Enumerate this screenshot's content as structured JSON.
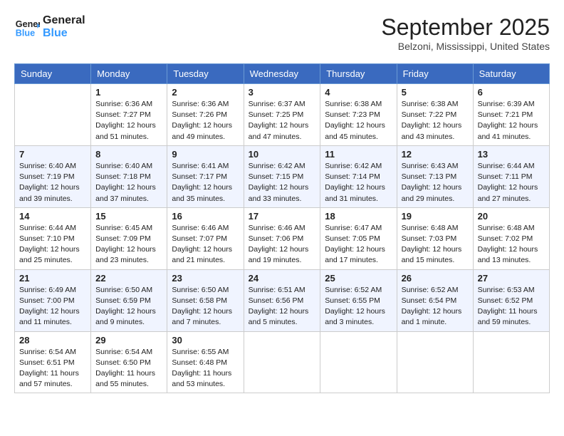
{
  "logo": {
    "line1": "General",
    "line2": "Blue"
  },
  "title": "September 2025",
  "location": "Belzoni, Mississippi, United States",
  "weekdays": [
    "Sunday",
    "Monday",
    "Tuesday",
    "Wednesday",
    "Thursday",
    "Friday",
    "Saturday"
  ],
  "weeks": [
    [
      {
        "day": "",
        "info": ""
      },
      {
        "day": "1",
        "info": "Sunrise: 6:36 AM\nSunset: 7:27 PM\nDaylight: 12 hours\nand 51 minutes."
      },
      {
        "day": "2",
        "info": "Sunrise: 6:36 AM\nSunset: 7:26 PM\nDaylight: 12 hours\nand 49 minutes."
      },
      {
        "day": "3",
        "info": "Sunrise: 6:37 AM\nSunset: 7:25 PM\nDaylight: 12 hours\nand 47 minutes."
      },
      {
        "day": "4",
        "info": "Sunrise: 6:38 AM\nSunset: 7:23 PM\nDaylight: 12 hours\nand 45 minutes."
      },
      {
        "day": "5",
        "info": "Sunrise: 6:38 AM\nSunset: 7:22 PM\nDaylight: 12 hours\nand 43 minutes."
      },
      {
        "day": "6",
        "info": "Sunrise: 6:39 AM\nSunset: 7:21 PM\nDaylight: 12 hours\nand 41 minutes."
      }
    ],
    [
      {
        "day": "7",
        "info": "Sunrise: 6:40 AM\nSunset: 7:19 PM\nDaylight: 12 hours\nand 39 minutes."
      },
      {
        "day": "8",
        "info": "Sunrise: 6:40 AM\nSunset: 7:18 PM\nDaylight: 12 hours\nand 37 minutes."
      },
      {
        "day": "9",
        "info": "Sunrise: 6:41 AM\nSunset: 7:17 PM\nDaylight: 12 hours\nand 35 minutes."
      },
      {
        "day": "10",
        "info": "Sunrise: 6:42 AM\nSunset: 7:15 PM\nDaylight: 12 hours\nand 33 minutes."
      },
      {
        "day": "11",
        "info": "Sunrise: 6:42 AM\nSunset: 7:14 PM\nDaylight: 12 hours\nand 31 minutes."
      },
      {
        "day": "12",
        "info": "Sunrise: 6:43 AM\nSunset: 7:13 PM\nDaylight: 12 hours\nand 29 minutes."
      },
      {
        "day": "13",
        "info": "Sunrise: 6:44 AM\nSunset: 7:11 PM\nDaylight: 12 hours\nand 27 minutes."
      }
    ],
    [
      {
        "day": "14",
        "info": "Sunrise: 6:44 AM\nSunset: 7:10 PM\nDaylight: 12 hours\nand 25 minutes."
      },
      {
        "day": "15",
        "info": "Sunrise: 6:45 AM\nSunset: 7:09 PM\nDaylight: 12 hours\nand 23 minutes."
      },
      {
        "day": "16",
        "info": "Sunrise: 6:46 AM\nSunset: 7:07 PM\nDaylight: 12 hours\nand 21 minutes."
      },
      {
        "day": "17",
        "info": "Sunrise: 6:46 AM\nSunset: 7:06 PM\nDaylight: 12 hours\nand 19 minutes."
      },
      {
        "day": "18",
        "info": "Sunrise: 6:47 AM\nSunset: 7:05 PM\nDaylight: 12 hours\nand 17 minutes."
      },
      {
        "day": "19",
        "info": "Sunrise: 6:48 AM\nSunset: 7:03 PM\nDaylight: 12 hours\nand 15 minutes."
      },
      {
        "day": "20",
        "info": "Sunrise: 6:48 AM\nSunset: 7:02 PM\nDaylight: 12 hours\nand 13 minutes."
      }
    ],
    [
      {
        "day": "21",
        "info": "Sunrise: 6:49 AM\nSunset: 7:00 PM\nDaylight: 12 hours\nand 11 minutes."
      },
      {
        "day": "22",
        "info": "Sunrise: 6:50 AM\nSunset: 6:59 PM\nDaylight: 12 hours\nand 9 minutes."
      },
      {
        "day": "23",
        "info": "Sunrise: 6:50 AM\nSunset: 6:58 PM\nDaylight: 12 hours\nand 7 minutes."
      },
      {
        "day": "24",
        "info": "Sunrise: 6:51 AM\nSunset: 6:56 PM\nDaylight: 12 hours\nand 5 minutes."
      },
      {
        "day": "25",
        "info": "Sunrise: 6:52 AM\nSunset: 6:55 PM\nDaylight: 12 hours\nand 3 minutes."
      },
      {
        "day": "26",
        "info": "Sunrise: 6:52 AM\nSunset: 6:54 PM\nDaylight: 12 hours\nand 1 minute."
      },
      {
        "day": "27",
        "info": "Sunrise: 6:53 AM\nSunset: 6:52 PM\nDaylight: 11 hours\nand 59 minutes."
      }
    ],
    [
      {
        "day": "28",
        "info": "Sunrise: 6:54 AM\nSunset: 6:51 PM\nDaylight: 11 hours\nand 57 minutes."
      },
      {
        "day": "29",
        "info": "Sunrise: 6:54 AM\nSunset: 6:50 PM\nDaylight: 11 hours\nand 55 minutes."
      },
      {
        "day": "30",
        "info": "Sunrise: 6:55 AM\nSunset: 6:48 PM\nDaylight: 11 hours\nand 53 minutes."
      },
      {
        "day": "",
        "info": ""
      },
      {
        "day": "",
        "info": ""
      },
      {
        "day": "",
        "info": ""
      },
      {
        "day": "",
        "info": ""
      }
    ]
  ]
}
